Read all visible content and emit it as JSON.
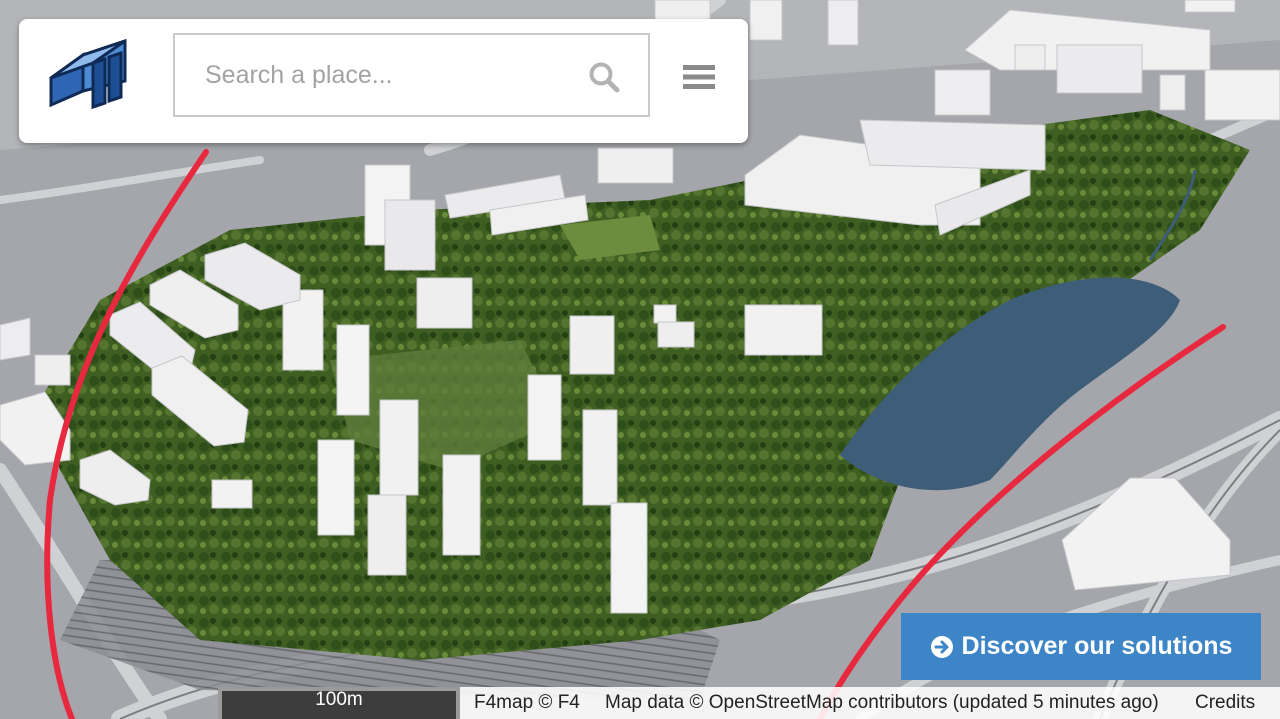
{
  "search": {
    "placeholder": "Search a place..."
  },
  "discover_button": {
    "label": "Discover our solutions"
  },
  "scale": {
    "label": "100m"
  },
  "attribution": {
    "f4map": "F4map © F4",
    "map_data": "Map data © OpenStreetMap contributors (updated 5 minutes ago)",
    "credits": "Credits"
  },
  "icons": [
    "f4-logo-icon",
    "search-icon",
    "hamburger-menu-icon",
    "circle-arrow-right-icon"
  ],
  "colors": {
    "accent": "#3d85c6",
    "annotation_red": "#e8283e",
    "water": "#3f5e7a",
    "park": "#4a6a2a"
  }
}
